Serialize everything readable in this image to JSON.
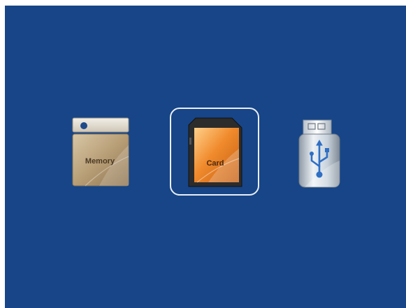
{
  "media_sources": [
    {
      "id": "memory",
      "label": "Memory",
      "icon": "internal-memory-icon",
      "selected": false
    },
    {
      "id": "card",
      "label": "Card",
      "icon": "sd-card-icon",
      "selected": true
    },
    {
      "id": "usb",
      "label": "",
      "icon": "usb-drive-icon",
      "selected": false
    }
  ],
  "colors": {
    "screen_background": "#174587",
    "selection_frame": "#e9eef6",
    "memory_tan": "#b49a72",
    "card_orange": "#f08a2c",
    "usb_silver": "#c8d2dc"
  }
}
